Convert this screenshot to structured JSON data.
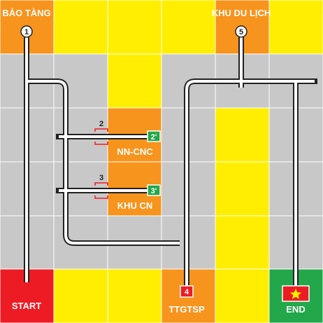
{
  "colors": {
    "yellow": "#ffee00",
    "orange": "#f7941d",
    "gray": "#c8c8c8",
    "red": "#ed1c24",
    "green": "#22a84a",
    "grid_line": "#ffffff",
    "road_outer": "#222222",
    "road_inner": "#ffffff"
  },
  "labels": {
    "museum": "BẢO TÀNG",
    "tourism": "KHU DU LỊCH",
    "nn_cnc": "NN-CNC",
    "khu_cn": "KHU CN",
    "start": "START",
    "ttgtsp": "TTGTSP",
    "end": "END"
  },
  "markers": {
    "m1": "1",
    "m5": "5",
    "m2": "2",
    "m3": "3",
    "m2p": "2'",
    "m3p": "3'",
    "m4": "4"
  }
}
